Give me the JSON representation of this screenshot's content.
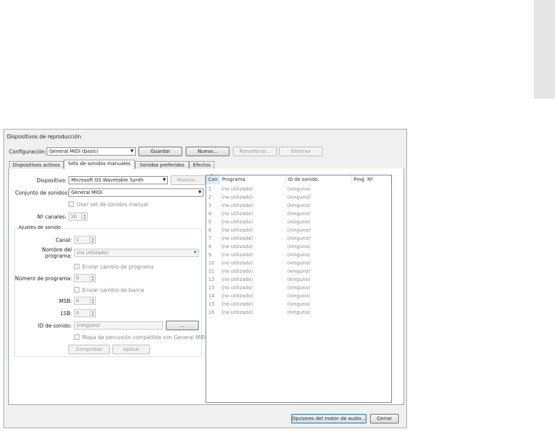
{
  "dialog": {
    "title": "Dispositivos de reproducción",
    "config_label": "Configuración:",
    "config_value": "General MIDI (basic)",
    "buttons": {
      "guardar": "Guardar",
      "nuevo": "Nuevo...",
      "renombrar": "Renombrar...",
      "eliminar": "Eliminar"
    },
    "tabs": [
      "Dispositivos activos",
      "Sets de sonidos manuales",
      "Sonidos preferidos",
      "Efectos"
    ],
    "active_tab": 1
  },
  "form": {
    "device_label": "Dispositivo:",
    "device_value": "Microsoft GS Wavetable Synth",
    "mostrar": "Mostrar...",
    "soundset_label": "Conjunto de sonidos:",
    "soundset_value": "General MIDI",
    "use_manual": "Usar set de sonidos manual",
    "channels_label": "Nº canales:",
    "channels_value": "16",
    "group_title": "Ajustes de sonido",
    "canal_label": "Canal:",
    "canal_value": "1",
    "program_name_label_1": "Nombre del",
    "program_name_label_2": "programa:",
    "program_name_value": "(no utilizado)",
    "send_program_change": "Enviar cambio de programa",
    "program_number_label": "Número de programa:",
    "program_number_value": "0",
    "send_bank_change": "Enviar cambio de banco",
    "msb_label": "MSB:",
    "msb_value": "0",
    "lsb_label": "LSB:",
    "lsb_value": "0",
    "sound_id_label": "ID de sonido:",
    "sound_id_value": "(ninguno)",
    "browse": "...",
    "gm_percussion": "Mapa de percusión compatible con General MIDI",
    "probar": "Comprobar",
    "aplicar": "Aplicar"
  },
  "list": {
    "sort_indicator": "^",
    "columns": [
      "Can",
      "Programa",
      "ID de sonido",
      "Prog. Nº"
    ],
    "rows": [
      {
        "ch": "1",
        "prog": "(no utilizado)",
        "id": "(ninguna)"
      },
      {
        "ch": "2",
        "prog": "(no utilizado)",
        "id": "(ninguna)"
      },
      {
        "ch": "3",
        "prog": "(no utilizado)",
        "id": "(ninguna)"
      },
      {
        "ch": "4",
        "prog": "(no utilizado)",
        "id": "(ninguna)"
      },
      {
        "ch": "5",
        "prog": "(no utilizado)",
        "id": "(ninguna)"
      },
      {
        "ch": "6",
        "prog": "(no utilizado)",
        "id": "(ninguna)"
      },
      {
        "ch": "7",
        "prog": "(no utilizado)",
        "id": "(ninguna)"
      },
      {
        "ch": "8",
        "prog": "(no utilizado)",
        "id": "(ninguna)"
      },
      {
        "ch": "9",
        "prog": "(no utilizado)",
        "id": "(ninguna)"
      },
      {
        "ch": "10",
        "prog": "(no utilizado)",
        "id": "(ninguna)"
      },
      {
        "ch": "11",
        "prog": "(no utilizado)",
        "id": "(ninguna)"
      },
      {
        "ch": "12",
        "prog": "(no utilizado)",
        "id": "(ninguna)"
      },
      {
        "ch": "13",
        "prog": "(no utilizado)",
        "id": "(ninguna)"
      },
      {
        "ch": "14",
        "prog": "(no utilizado)",
        "id": "(ninguna)"
      },
      {
        "ch": "15",
        "prog": "(no utilizado)",
        "id": "(ninguna)"
      },
      {
        "ch": "16",
        "prog": "(no utilizado)",
        "id": "(ninguna)"
      }
    ]
  },
  "footer": {
    "audio_engine": "Opciones del motor de audio...",
    "close": "Cerrar"
  },
  "icons": {
    "combo_arrow": "▼",
    "spin_up": "▲",
    "spin_down": "▼"
  }
}
